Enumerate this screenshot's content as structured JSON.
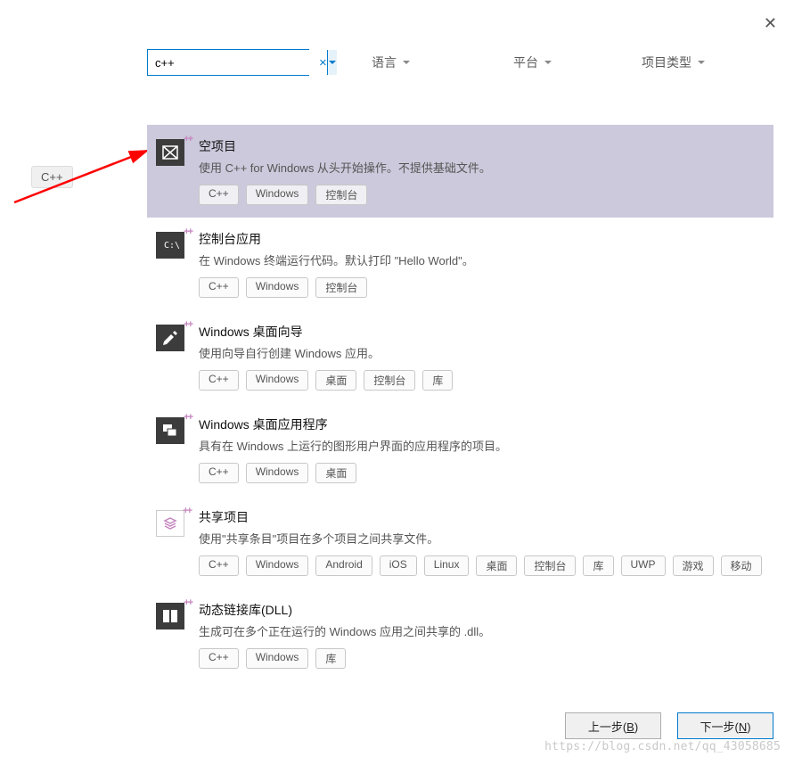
{
  "close_icon": "close-icon",
  "search": {
    "value": "c++",
    "clear_icon": "clear-icon",
    "dropdown_icon": "chevron-down-icon"
  },
  "filters": [
    {
      "label": "语言"
    },
    {
      "label": "平台"
    },
    {
      "label": "项目类型"
    }
  ],
  "tooltip": "C++",
  "templates": [
    {
      "selected": true,
      "icon": "empty-project-icon",
      "title": "空项目",
      "desc": "使用 C++ for Windows 从头开始操作。不提供基础文件。",
      "tags": [
        "C++",
        "Windows",
        "控制台"
      ]
    },
    {
      "selected": false,
      "icon": "console-app-icon",
      "title": "控制台应用",
      "desc": "在 Windows 终端运行代码。默认打印 \"Hello World\"。",
      "tags": [
        "C++",
        "Windows",
        "控制台"
      ]
    },
    {
      "selected": false,
      "icon": "wizard-icon",
      "title": "Windows 桌面向导",
      "desc": "使用向导自行创建 Windows 应用。",
      "tags": [
        "C++",
        "Windows",
        "桌面",
        "控制台",
        "库"
      ]
    },
    {
      "selected": false,
      "icon": "desktop-app-icon",
      "title": "Windows 桌面应用程序",
      "desc": "具有在 Windows 上运行的图形用户界面的应用程序的项目。",
      "tags": [
        "C++",
        "Windows",
        "桌面"
      ]
    },
    {
      "selected": false,
      "icon": "shared-project-icon",
      "title": "共享项目",
      "desc": "使用\"共享条目\"项目在多个项目之间共享文件。",
      "tags": [
        "C++",
        "Windows",
        "Android",
        "iOS",
        "Linux",
        "桌面",
        "控制台",
        "库",
        "UWP",
        "游戏",
        "移动"
      ]
    },
    {
      "selected": false,
      "icon": "dll-icon",
      "title": "动态链接库(DLL)",
      "desc": "生成可在多个正在运行的 Windows 应用之间共享的 .dll。",
      "tags": [
        "C++",
        "Windows",
        "库"
      ]
    }
  ],
  "buttons": {
    "prev_label": "上一步",
    "prev_key": "B",
    "next_label": "下一步",
    "next_key": "N"
  },
  "watermark": "https://blog.csdn.net/qq_43058685"
}
